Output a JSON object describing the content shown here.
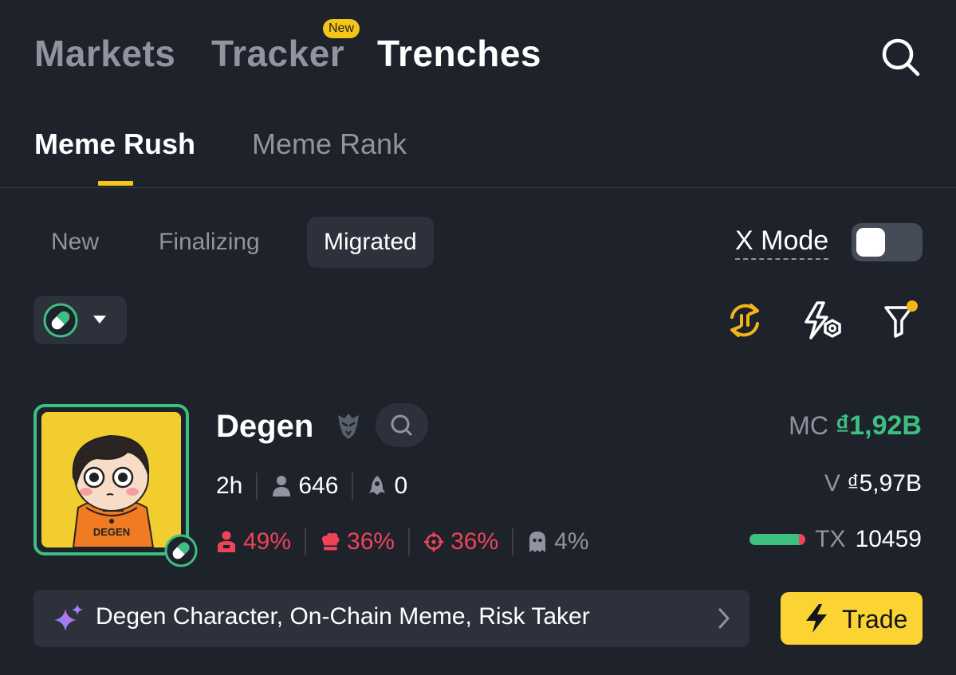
{
  "top_nav": {
    "tabs": [
      "Markets",
      "Tracker",
      "Trenches"
    ],
    "active_tab": "Trenches",
    "new_badge": "New"
  },
  "sub_nav": {
    "tabs": [
      "Meme Rush",
      "Meme Rank"
    ],
    "active_tab": "Meme Rush",
    "accent_color": "#f5c518"
  },
  "filters": {
    "tabs": [
      "New",
      "Finalizing",
      "Migrated"
    ],
    "active_tab": "Migrated",
    "x_mode_label": "X Mode",
    "x_mode_enabled": false
  },
  "toolbar": {
    "platform_icon": "pill-icon",
    "icons": [
      "pause-refresh-icon",
      "flash-settings-icon",
      "filter-icon"
    ]
  },
  "token": {
    "name": "Degen",
    "avatar_text": "DEGEN",
    "mc_label": "MC",
    "mc_value": "₫1,92B",
    "age": "2h",
    "holders": "646",
    "launches": "0",
    "v_label": "V",
    "v_value": "₫5,97B",
    "top_holders_pct": "49%",
    "dev_pct": "36%",
    "snipers_pct": "36%",
    "insiders_pct": "4%",
    "tx_label": "TX",
    "tx_value": "10459",
    "tx_buy_ratio": 0.88,
    "tags": "Degen Character, On-Chain Meme, Risk Taker",
    "trade_label": "Trade",
    "colors": {
      "positive": "#3ebf82",
      "negative": "#ef4458",
      "trade_button": "#fbd434"
    }
  }
}
